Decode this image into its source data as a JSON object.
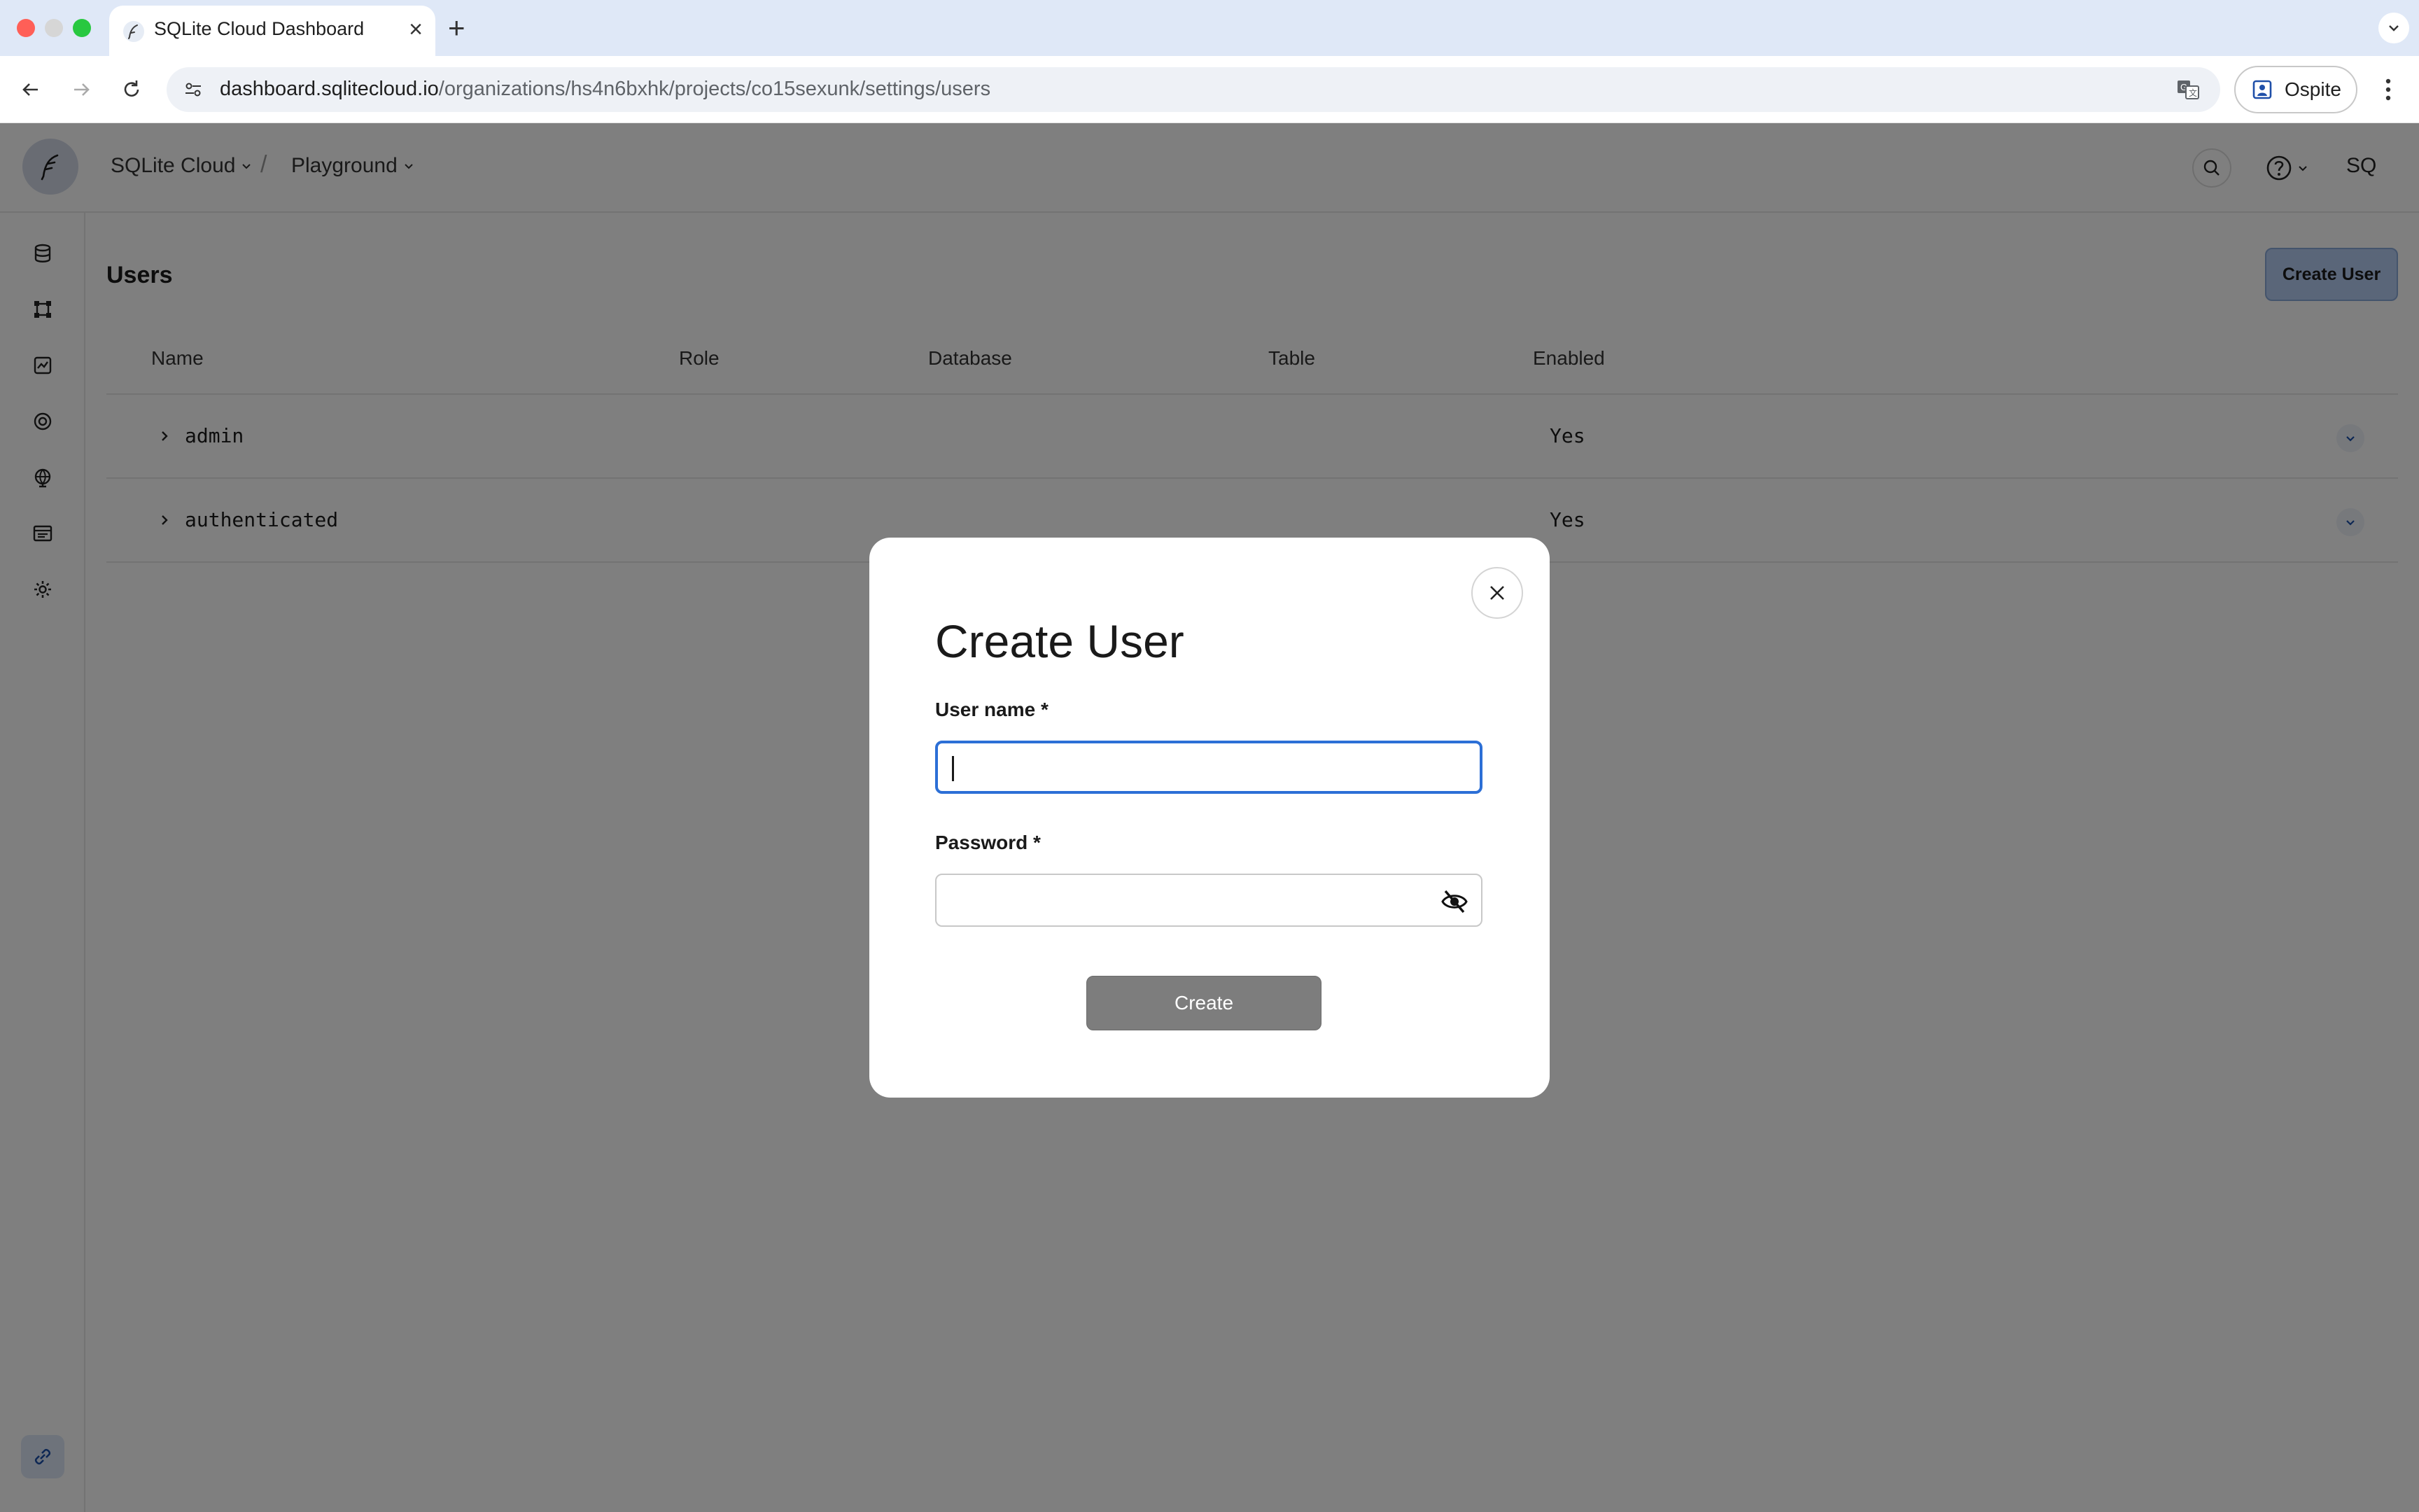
{
  "browser": {
    "tab": {
      "title": "SQLite Cloud Dashboard",
      "close_glyph": "×"
    },
    "newtab_glyph": "+",
    "url_host": "dashboard.sqlitecloud.io",
    "url_path": "/organizations/hs4n6bxhk/projects/co15sexunk/settings/users",
    "profile_label": "Ospite"
  },
  "app": {
    "org_label": "SQLite Cloud",
    "separator": "/",
    "project_label": "Playground",
    "avatar_initials": "SQ"
  },
  "sidebar": {
    "items": [
      "database-icon",
      "nodes-icon",
      "analyzer-icon",
      "weblite-icon",
      "edge-functions-icon",
      "logs-icon",
      "settings-icon"
    ],
    "bottom_item": "link-icon"
  },
  "main": {
    "title": "Users",
    "create_user_label": "Create User",
    "columns": [
      "Name",
      "Role",
      "Database",
      "Table",
      "Enabled"
    ],
    "rows": [
      {
        "name": "admin",
        "enabled": "Yes"
      },
      {
        "name": "authenticated",
        "enabled": "Yes"
      }
    ]
  },
  "modal": {
    "title": "Create User",
    "username_label": "User name *",
    "username_value": "",
    "password_label": "Password *",
    "password_value": "",
    "create_label": "Create"
  },
  "colors": {
    "accent": "#2c6fd6",
    "create_user_btn": "#b5cdf2",
    "overlay": "rgba(0,0,0,0.5)",
    "create_btn": "#7d7d7d"
  }
}
